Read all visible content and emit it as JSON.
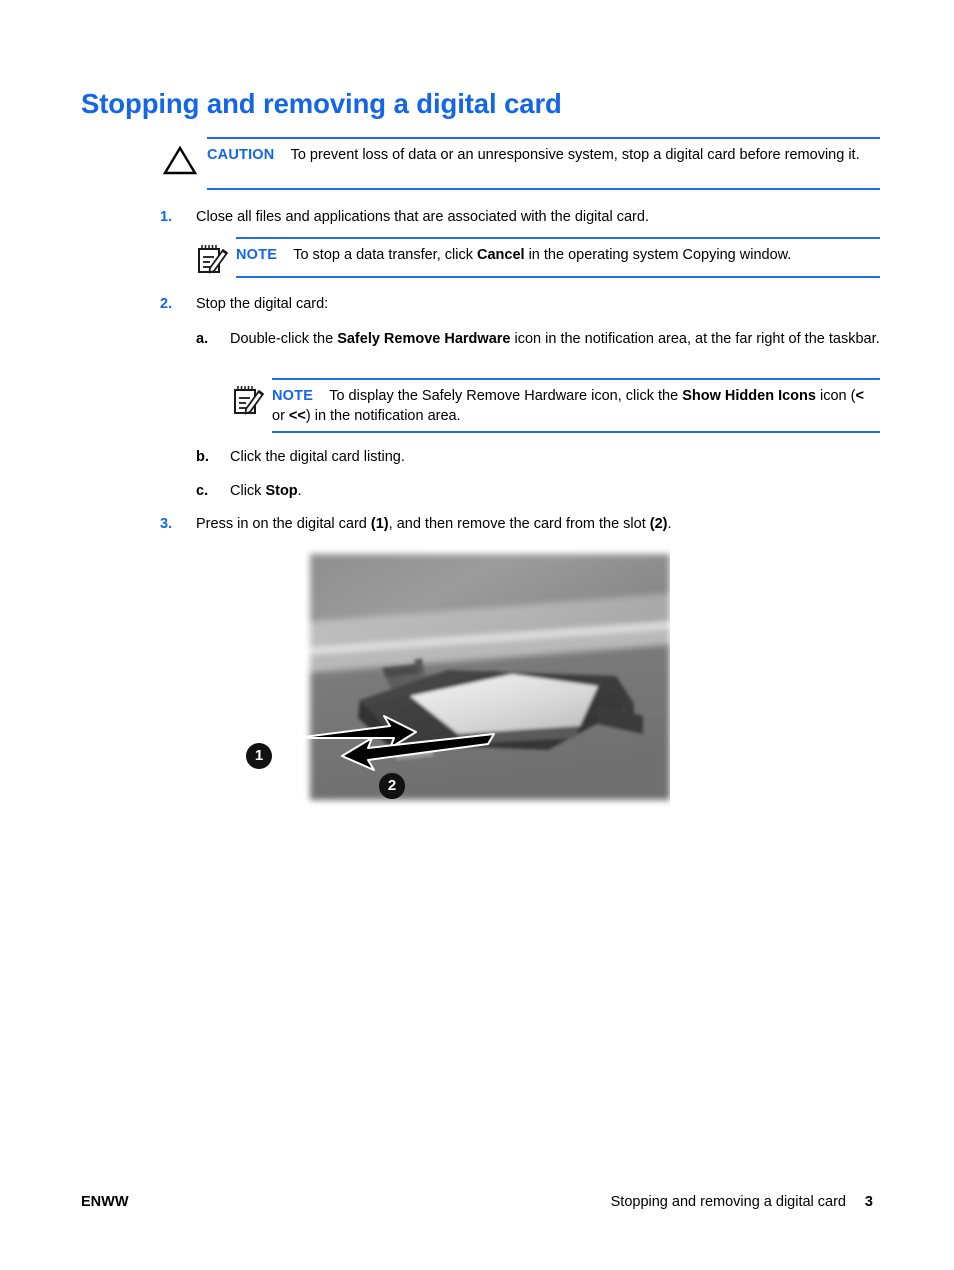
{
  "document": {
    "title": "Stopping and removing a digital card",
    "title_color": "#1366e8",
    "rule_color": "#1e6fd9"
  },
  "caution": {
    "icon": "caution-triangle-icon",
    "keyword": "CAUTION",
    "text": "To prevent loss of data or an unresponsive system, stop a digital card before removing it."
  },
  "steps": [
    {
      "number": "1.",
      "text_before": "Close all files and applications that are associated with the digital card.",
      "note": {
        "icon": "note-pad-pencil-icon",
        "keyword": "NOTE",
        "text_part1": "To stop a data transfer, click ",
        "bold1": "Cancel",
        "text_part2": " in the operating system Copying window."
      }
    },
    {
      "number": "2.",
      "text_before": "Stop the digital card:",
      "substeps": [
        {
          "letter": "a.",
          "text_part1": "Double-click the ",
          "bold1": "Safely Remove Hardware",
          "text_part2": " icon in the notification area, at the far right of the taskbar.",
          "note": {
            "icon": "note-pad-pencil-icon",
            "keyword": "NOTE",
            "text_part1": "To display the Safely Remove Hardware icon, click the ",
            "bold1": "Show Hidden Icons",
            "text_part2": " icon (",
            "bold2": "<",
            "text_part3": " or ",
            "bold3": "<<",
            "text_part4": ") in the notification area."
          }
        },
        {
          "letter": "b.",
          "text_part1": "Click the digital card listing.",
          "bold1": "",
          "text_part2": ""
        },
        {
          "letter": "c.",
          "text_part1": "Click ",
          "bold1": "Stop",
          "text_part2": "."
        }
      ]
    },
    {
      "number": "3.",
      "text_part1": "Press in on the digital card ",
      "bold1": "(1)",
      "text_part2": ", and then remove the card from the slot ",
      "bold2": "(2)",
      "text_part3": "."
    }
  ],
  "figure": {
    "name": "digital-card-slot-photo",
    "callouts": [
      {
        "label": "1"
      },
      {
        "label": "2"
      }
    ]
  },
  "footer": {
    "left": "ENWW",
    "title": "Stopping and removing a digital card",
    "page": "3"
  }
}
